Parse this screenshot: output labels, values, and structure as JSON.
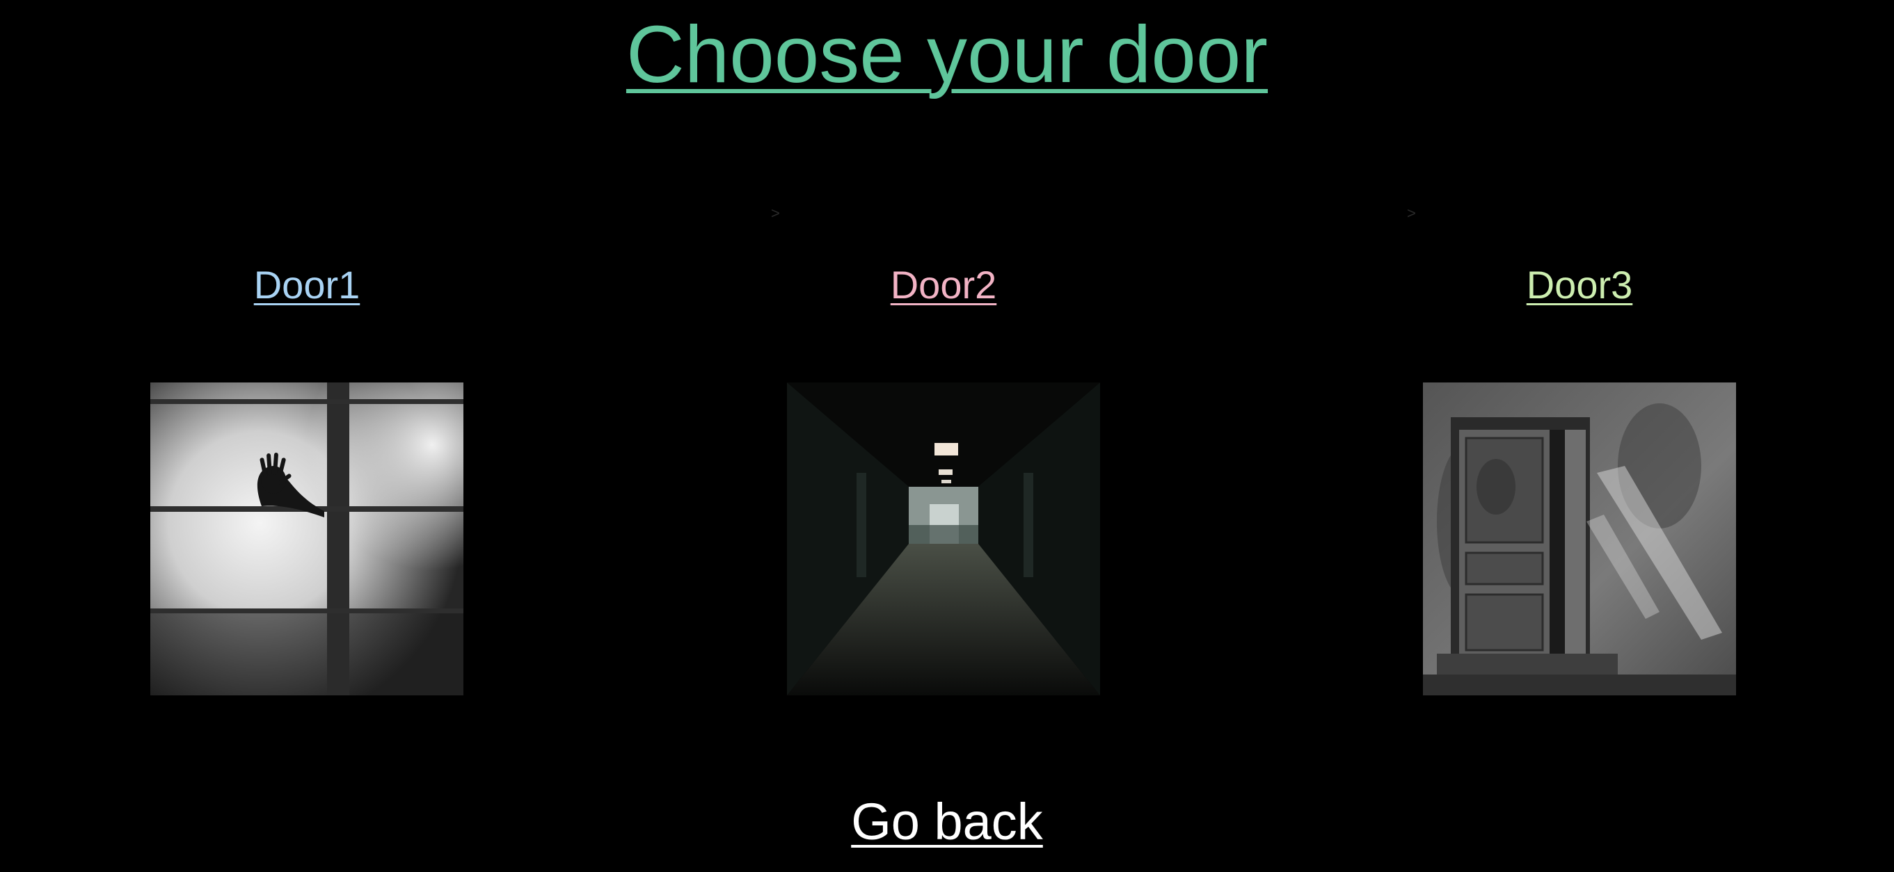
{
  "page": {
    "title": "Choose your door",
    "separators": [
      ">",
      ">"
    ],
    "colors": {
      "background": "#000000",
      "title": "#5fc69b",
      "go_back": "#ffffff"
    }
  },
  "doors": [
    {
      "label": "Door1",
      "color": "#a9d3f4",
      "image_icon": "hand-shadow-window-image"
    },
    {
      "label": "Door2",
      "color": "#f2b3c5",
      "image_icon": "dark-hallway-image"
    },
    {
      "label": "Door3",
      "color": "#cdeeb0",
      "image_icon": "old-wooden-door-image"
    }
  ],
  "footer": {
    "go_back_label": "Go back"
  }
}
